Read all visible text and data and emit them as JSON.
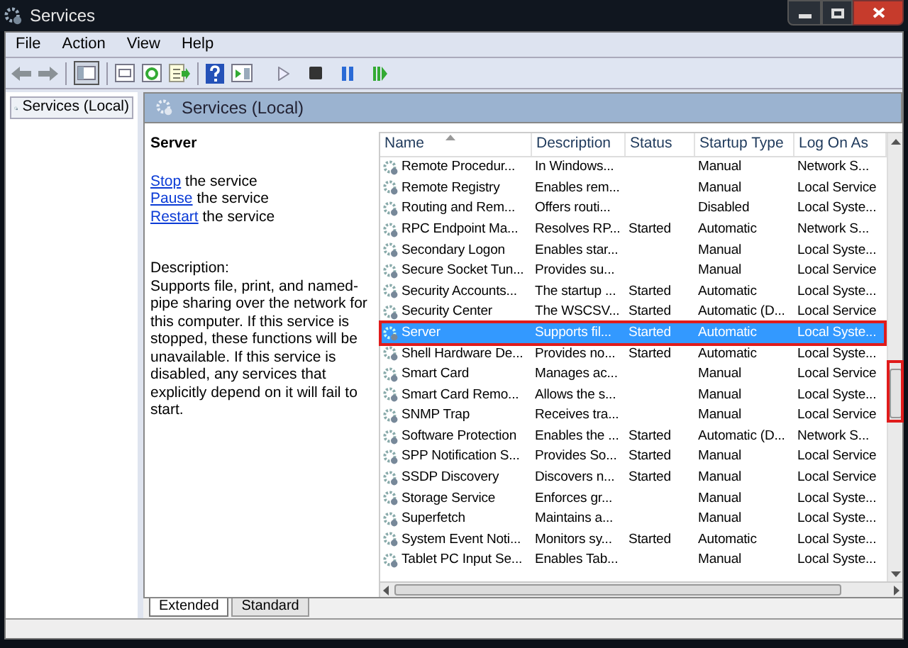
{
  "window": {
    "title": "Services"
  },
  "menu": [
    "File",
    "Action",
    "View",
    "Help"
  ],
  "tree": [
    {
      "label": "Services (Local)",
      "selected": true
    }
  ],
  "panel_title": "Services (Local)",
  "details": {
    "name": "Server",
    "actions": [
      {
        "link": "Stop",
        "text": "the service"
      },
      {
        "link": "Pause",
        "text": "the service"
      },
      {
        "link": "Restart",
        "text": "the service"
      }
    ],
    "description_label": "Description:",
    "description": "Supports file, print, and named-pipe sharing over the network for this computer. If this service is stopped, these functions will be unavailable. If this service is disabled, any services that explicitly depend on it will fail to start."
  },
  "table": {
    "columns": [
      {
        "label": "Name",
        "sorted": true
      },
      {
        "label": "Description",
        "sorted": false
      },
      {
        "label": "Status",
        "sorted": false
      },
      {
        "label": "Startup Type",
        "sorted": false
      },
      {
        "label": "Log On As",
        "sorted": false
      }
    ],
    "rows": [
      {
        "cells": [
          "Remote Procedur...",
          "In Windows...",
          "",
          "Manual",
          "Network S..."
        ],
        "selected": false,
        "outlined": false
      },
      {
        "cells": [
          "Remote Registry",
          "Enables rem...",
          "",
          "Manual",
          "Local Service"
        ],
        "selected": false,
        "outlined": false
      },
      {
        "cells": [
          "Routing and Rem...",
          "Offers routi...",
          "",
          "Disabled",
          "Local Syste..."
        ],
        "selected": false,
        "outlined": false
      },
      {
        "cells": [
          "RPC Endpoint Ma...",
          "Resolves RP...",
          "Started",
          "Automatic",
          "Network S..."
        ],
        "selected": false,
        "outlined": false
      },
      {
        "cells": [
          "Secondary Logon",
          "Enables star...",
          "",
          "Manual",
          "Local Syste..."
        ],
        "selected": false,
        "outlined": false
      },
      {
        "cells": [
          "Secure Socket Tun...",
          "Provides su...",
          "",
          "Manual",
          "Local Service"
        ],
        "selected": false,
        "outlined": false
      },
      {
        "cells": [
          "Security Accounts...",
          "The startup ...",
          "Started",
          "Automatic",
          "Local Syste..."
        ],
        "selected": false,
        "outlined": false
      },
      {
        "cells": [
          "Security Center",
          "The WSCSV...",
          "Started",
          "Automatic (D...",
          "Local Service"
        ],
        "selected": false,
        "outlined": false
      },
      {
        "cells": [
          "Server",
          "Supports fil...",
          "Started",
          "Automatic",
          "Local Syste..."
        ],
        "selected": true,
        "outlined": true
      },
      {
        "cells": [
          "Shell Hardware De...",
          "Provides no...",
          "Started",
          "Automatic",
          "Local Syste..."
        ],
        "selected": false,
        "outlined": false
      },
      {
        "cells": [
          "Smart Card",
          "Manages ac...",
          "",
          "Manual",
          "Local Service"
        ],
        "selected": false,
        "outlined": false
      },
      {
        "cells": [
          "Smart Card Remo...",
          "Allows the s...",
          "",
          "Manual",
          "Local Syste..."
        ],
        "selected": false,
        "outlined": false
      },
      {
        "cells": [
          "SNMP Trap",
          "Receives tra...",
          "",
          "Manual",
          "Local Service"
        ],
        "selected": false,
        "outlined": false
      },
      {
        "cells": [
          "Software Protection",
          "Enables the ...",
          "Started",
          "Automatic (D...",
          "Network S..."
        ],
        "selected": false,
        "outlined": false
      },
      {
        "cells": [
          "SPP Notification S...",
          "Provides So...",
          "Started",
          "Manual",
          "Local Service"
        ],
        "selected": false,
        "outlined": false
      },
      {
        "cells": [
          "SSDP Discovery",
          "Discovers n...",
          "Started",
          "Manual",
          "Local Service"
        ],
        "selected": false,
        "outlined": false
      },
      {
        "cells": [
          "Storage Service",
          "Enforces gr...",
          "",
          "Manual",
          "Local Syste..."
        ],
        "selected": false,
        "outlined": false
      },
      {
        "cells": [
          "Superfetch",
          "Maintains a...",
          "",
          "Manual",
          "Local Syste..."
        ],
        "selected": false,
        "outlined": false
      },
      {
        "cells": [
          "System Event Noti...",
          "Monitors sy...",
          "Started",
          "Automatic",
          "Local Syste..."
        ],
        "selected": false,
        "outlined": false
      },
      {
        "cells": [
          "Tablet PC Input Se...",
          "Enables Tab...",
          "",
          "Manual",
          "Local Syste..."
        ],
        "selected": false,
        "outlined": false
      }
    ]
  },
  "tabs": [
    {
      "label": "Extended",
      "selected": true
    },
    {
      "label": "Standard",
      "selected": false
    }
  ]
}
